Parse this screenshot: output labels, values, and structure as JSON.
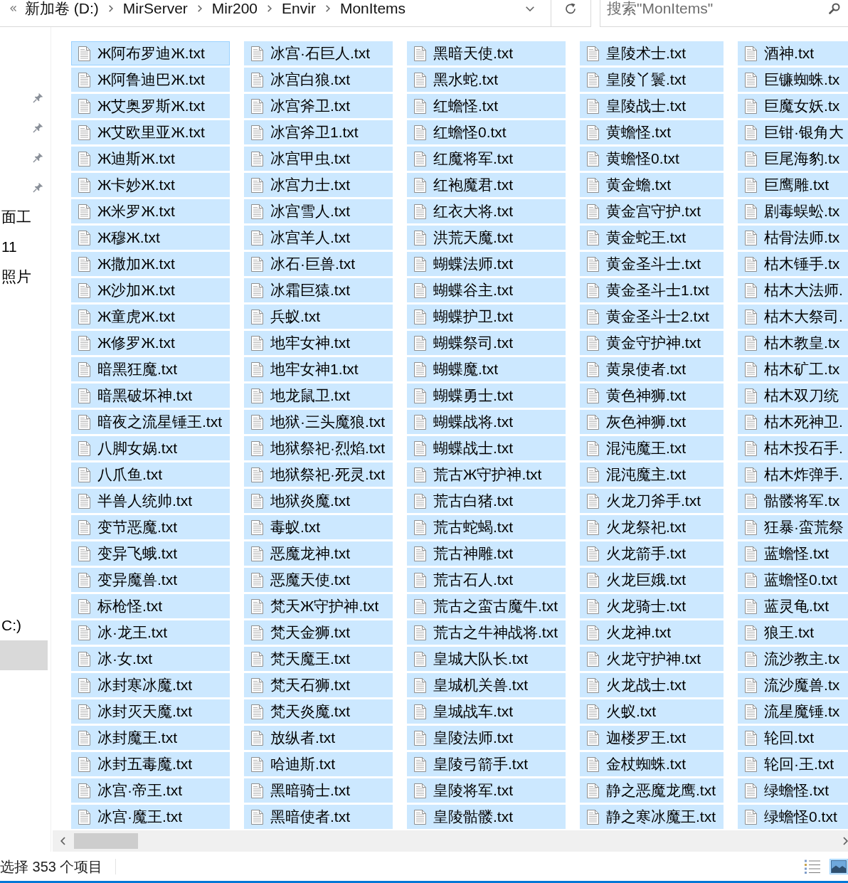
{
  "address_bar": {
    "crumbs": [
      "新加卷 (D:)",
      "MirServer",
      "Mir200",
      "Envir",
      "MonItems"
    ]
  },
  "search": {
    "placeholder": "搜索\"MonItems\""
  },
  "nav_pane": {
    "groups": [
      {
        "items": [
          {
            "pinned": true,
            "selected": false
          },
          {
            "pinned": true,
            "selected": false
          },
          {
            "pinned": true,
            "selected": false
          },
          {
            "pinned": true,
            "selected": false
          },
          {
            "label": "面工",
            "pinned": false,
            "selected": false
          },
          {
            "label": "11",
            "pinned": false,
            "selected": false
          },
          {
            "label": "照片",
            "pinned": false,
            "selected": false
          }
        ]
      },
      {
        "items": [
          {
            "label": "C:)",
            "pinned": false,
            "selected": false
          },
          {
            "pinned": false,
            "selected": true
          }
        ]
      }
    ]
  },
  "files": [
    {
      "name": "Ж阿布罗迪Ж.txt",
      "selected": true,
      "focused": true
    },
    {
      "name": "Ж阿鲁迪巴Ж.txt",
      "selected": true,
      "focused": false
    },
    {
      "name": "Ж艾奥罗斯Ж.txt",
      "selected": true,
      "focused": false
    },
    {
      "name": "Ж艾欧里亚Ж.txt",
      "selected": true,
      "focused": false
    },
    {
      "name": "Ж迪斯Ж.txt",
      "selected": true,
      "focused": false
    },
    {
      "name": "Ж卡妙Ж.txt",
      "selected": true,
      "focused": false
    },
    {
      "name": "Ж米罗Ж.txt",
      "selected": true,
      "focused": false
    },
    {
      "name": "Ж穆Ж.txt",
      "selected": true,
      "focused": false
    },
    {
      "name": "Ж撒加Ж.txt",
      "selected": true,
      "focused": false
    },
    {
      "name": "Ж沙加Ж.txt",
      "selected": true,
      "focused": false
    },
    {
      "name": "Ж童虎Ж.txt",
      "selected": true,
      "focused": false
    },
    {
      "name": "Ж修罗Ж.txt",
      "selected": true,
      "focused": false
    },
    {
      "name": "暗黑狂魔.txt",
      "selected": true,
      "focused": false
    },
    {
      "name": "暗黑破坏神.txt",
      "selected": true,
      "focused": false
    },
    {
      "name": "暗夜之流星锤王.txt",
      "selected": true,
      "focused": false
    },
    {
      "name": "八脚女娲.txt",
      "selected": true,
      "focused": false
    },
    {
      "name": "八爪鱼.txt",
      "selected": true,
      "focused": false
    },
    {
      "name": "半兽人统帅.txt",
      "selected": true,
      "focused": false
    },
    {
      "name": "变节恶魔.txt",
      "selected": true,
      "focused": false
    },
    {
      "name": "变异飞蛾.txt",
      "selected": true,
      "focused": false
    },
    {
      "name": "变异魔兽.txt",
      "selected": true,
      "focused": false
    },
    {
      "name": "标枪怪.txt",
      "selected": true,
      "focused": false
    },
    {
      "name": "冰·龙王.txt",
      "selected": true,
      "focused": false
    },
    {
      "name": "冰·女.txt",
      "selected": true,
      "focused": false
    },
    {
      "name": "冰封寒冰魔.txt",
      "selected": true,
      "focused": false
    },
    {
      "name": "冰封灭天魔.txt",
      "selected": true,
      "focused": false
    },
    {
      "name": "冰封魔王.txt",
      "selected": true,
      "focused": false
    },
    {
      "name": "冰封五毒魔.txt",
      "selected": true,
      "focused": false
    },
    {
      "name": "冰宫·帝王.txt",
      "selected": true,
      "focused": false
    },
    {
      "name": "冰宫·魔王.txt",
      "selected": true,
      "focused": false
    },
    {
      "name": "冰宫·石巨人.txt",
      "selected": true,
      "focused": false
    },
    {
      "name": "冰宫白狼.txt",
      "selected": true,
      "focused": false
    },
    {
      "name": "冰宫斧卫.txt",
      "selected": true,
      "focused": false
    },
    {
      "name": "冰宫斧卫1.txt",
      "selected": true,
      "focused": false
    },
    {
      "name": "冰宫甲虫.txt",
      "selected": true,
      "focused": false
    },
    {
      "name": "冰宫力士.txt",
      "selected": true,
      "focused": false
    },
    {
      "name": "冰宫雪人.txt",
      "selected": true,
      "focused": false
    },
    {
      "name": "冰宫羊人.txt",
      "selected": true,
      "focused": false
    },
    {
      "name": "冰石·巨兽.txt",
      "selected": true,
      "focused": false
    },
    {
      "name": "冰霜巨猿.txt",
      "selected": true,
      "focused": false
    },
    {
      "name": "兵蚁.txt",
      "selected": true,
      "focused": false
    },
    {
      "name": "地牢女神.txt",
      "selected": true,
      "focused": false
    },
    {
      "name": "地牢女神1.txt",
      "selected": true,
      "focused": false
    },
    {
      "name": "地龙鼠卫.txt",
      "selected": true,
      "focused": false
    },
    {
      "name": "地狱·三头魔狼.txt",
      "selected": true,
      "focused": false
    },
    {
      "name": "地狱祭祀·烈焰.txt",
      "selected": true,
      "focused": false
    },
    {
      "name": "地狱祭祀·死灵.txt",
      "selected": true,
      "focused": false
    },
    {
      "name": "地狱炎魔.txt",
      "selected": true,
      "focused": false
    },
    {
      "name": "毒蚁.txt",
      "selected": true,
      "focused": false
    },
    {
      "name": "恶魔龙神.txt",
      "selected": true,
      "focused": false
    },
    {
      "name": "恶魔天使.txt",
      "selected": true,
      "focused": false
    },
    {
      "name": "梵天Ж守护神.txt",
      "selected": true,
      "focused": false
    },
    {
      "name": "梵天金狮.txt",
      "selected": true,
      "focused": false
    },
    {
      "name": "梵天魔王.txt",
      "selected": true,
      "focused": false
    },
    {
      "name": "梵天石狮.txt",
      "selected": true,
      "focused": false
    },
    {
      "name": "梵天炎魔.txt",
      "selected": true,
      "focused": false
    },
    {
      "name": "放纵者.txt",
      "selected": true,
      "focused": false
    },
    {
      "name": "哈迪斯.txt",
      "selected": true,
      "focused": false
    },
    {
      "name": "黑暗骑士.txt",
      "selected": true,
      "focused": false
    },
    {
      "name": "黑暗使者.txt",
      "selected": true,
      "focused": false
    },
    {
      "name": "黑暗天使.txt",
      "selected": true,
      "focused": false
    },
    {
      "name": "黑水蛇.txt",
      "selected": true,
      "focused": false
    },
    {
      "name": "红蟾怪.txt",
      "selected": true,
      "focused": false
    },
    {
      "name": "红蟾怪0.txt",
      "selected": true,
      "focused": false
    },
    {
      "name": "红魔将军.txt",
      "selected": true,
      "focused": false
    },
    {
      "name": "红袍魔君.txt",
      "selected": true,
      "focused": false
    },
    {
      "name": "红衣大将.txt",
      "selected": true,
      "focused": false
    },
    {
      "name": "洪荒天魔.txt",
      "selected": true,
      "focused": false
    },
    {
      "name": "蝴蝶法师.txt",
      "selected": true,
      "focused": false
    },
    {
      "name": "蝴蝶谷主.txt",
      "selected": true,
      "focused": false
    },
    {
      "name": "蝴蝶护卫.txt",
      "selected": true,
      "focused": false
    },
    {
      "name": "蝴蝶祭司.txt",
      "selected": true,
      "focused": false
    },
    {
      "name": "蝴蝶魔.txt",
      "selected": true,
      "focused": false
    },
    {
      "name": "蝴蝶勇士.txt",
      "selected": true,
      "focused": false
    },
    {
      "name": "蝴蝶战将.txt",
      "selected": true,
      "focused": false
    },
    {
      "name": "蝴蝶战士.txt",
      "selected": true,
      "focused": false
    },
    {
      "name": "荒古Ж守护神.txt",
      "selected": true,
      "focused": false
    },
    {
      "name": "荒古白猪.txt",
      "selected": true,
      "focused": false
    },
    {
      "name": "荒古蛇蝎.txt",
      "selected": true,
      "focused": false
    },
    {
      "name": "荒古神雕.txt",
      "selected": true,
      "focused": false
    },
    {
      "name": "荒古石人.txt",
      "selected": true,
      "focused": false
    },
    {
      "name": "荒古之蛮古魔牛.txt",
      "selected": true,
      "focused": false
    },
    {
      "name": "荒古之牛神战将.txt",
      "selected": true,
      "focused": false
    },
    {
      "name": "皇城大队长.txt",
      "selected": true,
      "focused": false
    },
    {
      "name": "皇城机关兽.txt",
      "selected": true,
      "focused": false
    },
    {
      "name": "皇城战车.txt",
      "selected": true,
      "focused": false
    },
    {
      "name": "皇陵法师.txt",
      "selected": true,
      "focused": false
    },
    {
      "name": "皇陵弓箭手.txt",
      "selected": true,
      "focused": false
    },
    {
      "name": "皇陵将军.txt",
      "selected": true,
      "focused": false
    },
    {
      "name": "皇陵骷髅.txt",
      "selected": true,
      "focused": false
    },
    {
      "name": "皇陵术士.txt",
      "selected": true,
      "focused": false
    },
    {
      "name": "皇陵丫鬟.txt",
      "selected": true,
      "focused": false
    },
    {
      "name": "皇陵战士.txt",
      "selected": true,
      "focused": false
    },
    {
      "name": "黄蟾怪.txt",
      "selected": true,
      "focused": false
    },
    {
      "name": "黄蟾怪0.txt",
      "selected": true,
      "focused": false
    },
    {
      "name": "黄金蟾.txt",
      "selected": true,
      "focused": false
    },
    {
      "name": "黄金宫守护.txt",
      "selected": true,
      "focused": false
    },
    {
      "name": "黄金蛇王.txt",
      "selected": true,
      "focused": false
    },
    {
      "name": "黄金圣斗士.txt",
      "selected": true,
      "focused": false
    },
    {
      "name": "黄金圣斗士1.txt",
      "selected": true,
      "focused": false
    },
    {
      "name": "黄金圣斗士2.txt",
      "selected": true,
      "focused": false
    },
    {
      "name": "黄金守护神.txt",
      "selected": true,
      "focused": false
    },
    {
      "name": "黄泉使者.txt",
      "selected": true,
      "focused": false
    },
    {
      "name": "黄色神狮.txt",
      "selected": true,
      "focused": false
    },
    {
      "name": "灰色神狮.txt",
      "selected": true,
      "focused": false
    },
    {
      "name": "混沌魔王.txt",
      "selected": true,
      "focused": false
    },
    {
      "name": "混沌魔主.txt",
      "selected": true,
      "focused": false
    },
    {
      "name": "火龙刀斧手.txt",
      "selected": true,
      "focused": false
    },
    {
      "name": "火龙祭祀.txt",
      "selected": true,
      "focused": false
    },
    {
      "name": "火龙箭手.txt",
      "selected": true,
      "focused": false
    },
    {
      "name": "火龙巨娥.txt",
      "selected": true,
      "focused": false
    },
    {
      "name": "火龙骑士.txt",
      "selected": true,
      "focused": false
    },
    {
      "name": "火龙神.txt",
      "selected": true,
      "focused": false
    },
    {
      "name": "火龙守护神.txt",
      "selected": true,
      "focused": false
    },
    {
      "name": "火龙战士.txt",
      "selected": true,
      "focused": false
    },
    {
      "name": "火蚁.txt",
      "selected": true,
      "focused": false
    },
    {
      "name": "迦楼罗王.txt",
      "selected": true,
      "focused": false
    },
    {
      "name": "金杖蜘蛛.txt",
      "selected": true,
      "focused": false
    },
    {
      "name": "静之恶魔龙鹰.txt",
      "selected": true,
      "focused": false
    },
    {
      "name": "静之寒冰魔王.txt",
      "selected": true,
      "focused": false
    },
    {
      "name": "酒神.txt",
      "selected": true,
      "focused": false
    },
    {
      "name": "巨镰蜘蛛.tx",
      "selected": true,
      "focused": false
    },
    {
      "name": "巨魔女妖.tx",
      "selected": true,
      "focused": false
    },
    {
      "name": "巨钳·银角大",
      "selected": true,
      "focused": false
    },
    {
      "name": "巨尾海豹.tx",
      "selected": true,
      "focused": false
    },
    {
      "name": "巨鹰雕.txt",
      "selected": true,
      "focused": false
    },
    {
      "name": "剧毒蜈蚣.tx",
      "selected": true,
      "focused": false
    },
    {
      "name": "枯骨法师.tx",
      "selected": true,
      "focused": false
    },
    {
      "name": "枯木锤手.tx",
      "selected": true,
      "focused": false
    },
    {
      "name": "枯木大法师.",
      "selected": true,
      "focused": false
    },
    {
      "name": "枯木大祭司.",
      "selected": true,
      "focused": false
    },
    {
      "name": "枯木教皇.tx",
      "selected": true,
      "focused": false
    },
    {
      "name": "枯木矿工.tx",
      "selected": true,
      "focused": false
    },
    {
      "name": "枯木双刀统",
      "selected": true,
      "focused": false
    },
    {
      "name": "枯木死神卫.",
      "selected": true,
      "focused": false
    },
    {
      "name": "枯木投石手.",
      "selected": true,
      "focused": false
    },
    {
      "name": "枯木炸弹手.",
      "selected": true,
      "focused": false
    },
    {
      "name": "骷髅将军.tx",
      "selected": true,
      "focused": false
    },
    {
      "name": "狂暴·蛮荒祭",
      "selected": true,
      "focused": false
    },
    {
      "name": "蓝蟾怪.txt",
      "selected": true,
      "focused": false
    },
    {
      "name": "蓝蟾怪0.txt",
      "selected": true,
      "focused": false
    },
    {
      "name": "蓝灵龟.txt",
      "selected": true,
      "focused": false
    },
    {
      "name": "狼王.txt",
      "selected": true,
      "focused": false
    },
    {
      "name": "流沙教主.tx",
      "selected": true,
      "focused": false
    },
    {
      "name": "流沙魔兽.tx",
      "selected": true,
      "focused": false
    },
    {
      "name": "流星魔锤.tx",
      "selected": true,
      "focused": false
    },
    {
      "name": "轮回.txt",
      "selected": true,
      "focused": false
    },
    {
      "name": "轮回·王.txt",
      "selected": true,
      "focused": false
    },
    {
      "name": "绿蟾怪.txt",
      "selected": true,
      "focused": false
    },
    {
      "name": "绿蟾怪0.txt",
      "selected": true,
      "focused": false
    }
  ],
  "status_bar": {
    "text": "选择 353 个项目",
    "views": [
      {
        "kind": "details",
        "selected": false
      },
      {
        "kind": "large_icons",
        "selected": true
      }
    ]
  }
}
